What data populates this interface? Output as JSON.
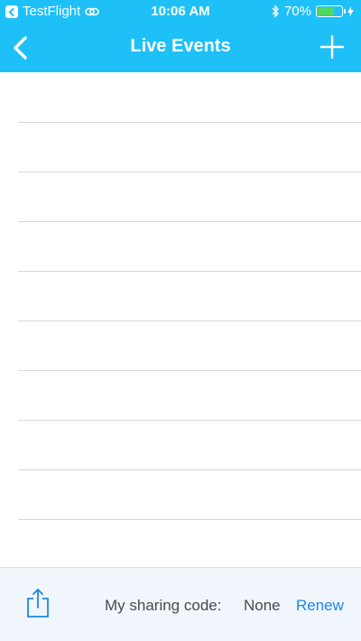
{
  "status_bar": {
    "back_app": "TestFlight",
    "time": "10:06 AM",
    "battery_percent": "70%",
    "battery_level": 0.7,
    "icons": [
      "back-app-icon",
      "link-icon",
      "bluetooth-icon",
      "battery-icon",
      "charging-icon"
    ]
  },
  "nav": {
    "title": "Live Events",
    "back_icon": "chevron-left-icon",
    "add_icon": "plus-icon"
  },
  "list": {
    "rows": [
      "",
      "",
      "",
      "",
      "",
      "",
      "",
      "",
      "",
      ""
    ]
  },
  "toolbar": {
    "share_icon": "share-icon",
    "sharing_label": "My sharing code:",
    "sharing_value": "None",
    "renew_label": "Renew"
  },
  "colors": {
    "header": "#1ec0f8",
    "accent": "#1e88e5",
    "battery_fill": "#4cd964",
    "toolbar_bg": "#f0f6fc"
  }
}
